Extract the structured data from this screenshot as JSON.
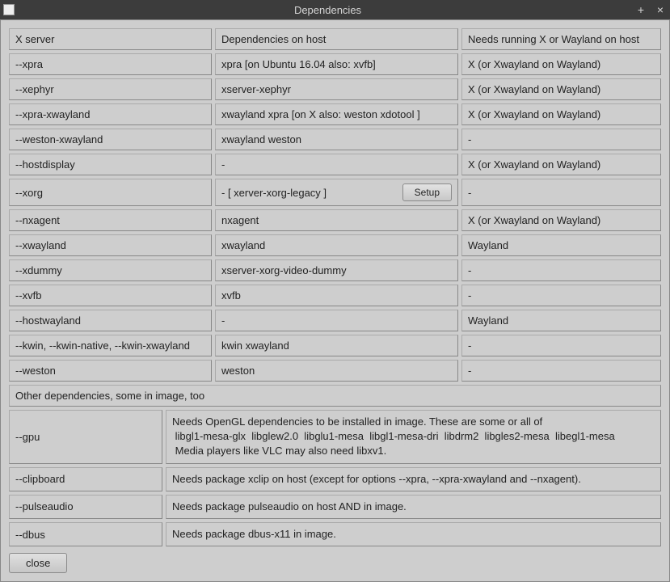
{
  "titlebar": {
    "title": "Dependencies",
    "minimize": "+",
    "close": "×"
  },
  "header_row": {
    "col1": "X server",
    "col2": "Dependencies on host",
    "col3": "Needs running X or Wayland on host"
  },
  "rows": [
    {
      "opt": "--xpra",
      "dep": "xpra  [on Ubuntu 16.04 also: xvfb]",
      "need": "X  (or Xwayland on Wayland)",
      "setup": false
    },
    {
      "opt": "--xephyr",
      "dep": "xserver-xephyr",
      "need": "X  (or Xwayland on Wayland)",
      "setup": false
    },
    {
      "opt": "--xpra-xwayland",
      "dep": "xwayland  xpra  [on X also:  weston  xdotool ]",
      "need": "X  (or Xwayland on Wayland)",
      "setup": false
    },
    {
      "opt": "--weston-xwayland",
      "dep": "xwayland  weston",
      "need": "-",
      "setup": false
    },
    {
      "opt": "--hostdisplay",
      "dep": "-",
      "need": "X  (or Xwayland on Wayland)",
      "setup": false
    },
    {
      "opt": "--xorg",
      "dep": "-  [ xerver-xorg-legacy ]",
      "need": "-",
      "setup": true
    },
    {
      "opt": "--nxagent",
      "dep": "nxagent",
      "need": "X  (or Xwayland on Wayland)",
      "setup": false
    },
    {
      "opt": "--xwayland",
      "dep": "xwayland",
      "need": "Wayland",
      "setup": false
    },
    {
      "opt": "--xdummy",
      "dep": "xserver-xorg-video-dummy",
      "need": "-",
      "setup": false
    },
    {
      "opt": "--xvfb",
      "dep": "xvfb",
      "need": "-",
      "setup": false
    },
    {
      "opt": "--hostwayland",
      "dep": "-",
      "need": "Wayland",
      "setup": false
    },
    {
      "opt": "--kwin, --kwin-native, --kwin-xwayland",
      "dep": "kwin xwayland",
      "need": "-",
      "setup": false
    },
    {
      "opt": "--weston",
      "dep": "weston",
      "need": "-",
      "setup": false
    }
  ],
  "setup_label": "Setup",
  "section2_heading": "Other dependencies, some in image, too",
  "other": [
    {
      "opt": "--gpu",
      "desc": "Needs OpenGL dependencies to be installed in image. These are some or all of\n libgl1-mesa-glx  libglew2.0  libglu1-mesa  libgl1-mesa-dri  libdrm2  libgles2-mesa  libegl1-mesa\n Media players like VLC may also need libxv1."
    },
    {
      "opt": "--clipboard",
      "desc": "Needs package xclip on host (except for options --xpra, --xpra-xwayland and --nxagent)."
    },
    {
      "opt": "--pulseaudio",
      "desc": "Needs package pulseaudio on host AND in image."
    },
    {
      "opt": "--dbus",
      "desc": "Needs package dbus-x11 in image."
    }
  ],
  "close_label": "close"
}
